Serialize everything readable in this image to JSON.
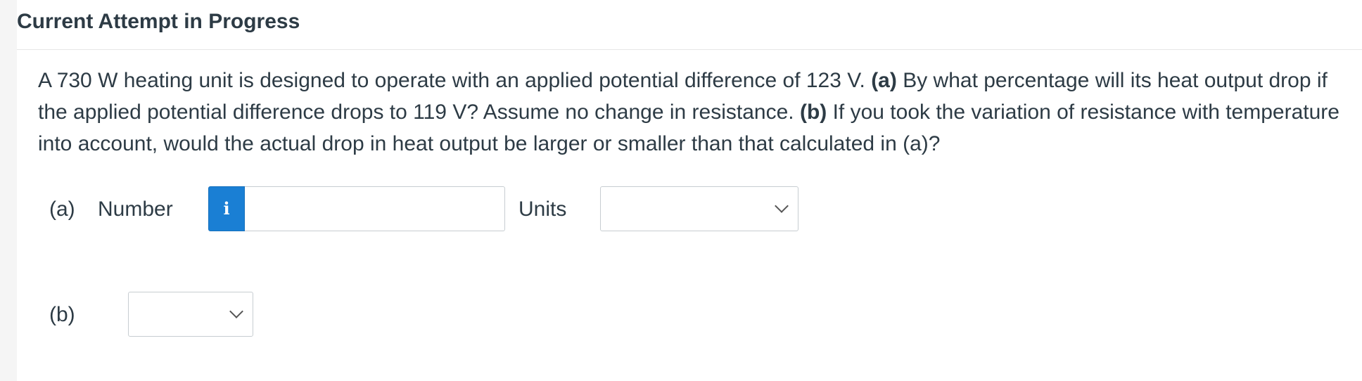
{
  "header": {
    "title": "Current Attempt in Progress"
  },
  "question": {
    "seg1": "A 730 W heating unit is designed to operate with an applied potential difference of 123 V. ",
    "a_marker": "(a)",
    "seg2": " By what percentage will its heat output drop if the applied potential difference drops to 119 V? Assume no change in resistance. ",
    "b_marker": "(b)",
    "seg3": " If you took the variation of resistance with temperature into account, would the actual drop in heat output be larger or smaller than that calculated in (a)?"
  },
  "part_a": {
    "label": "(a)",
    "number_label": "Number",
    "info_icon_glyph": "i",
    "number_value": "",
    "units_label": "Units",
    "units_selected": ""
  },
  "part_b": {
    "label": "(b)",
    "selected": ""
  },
  "colors": {
    "info_button": "#1a7fd4",
    "text": "#2d3b45",
    "border": "#c7cdd1"
  }
}
